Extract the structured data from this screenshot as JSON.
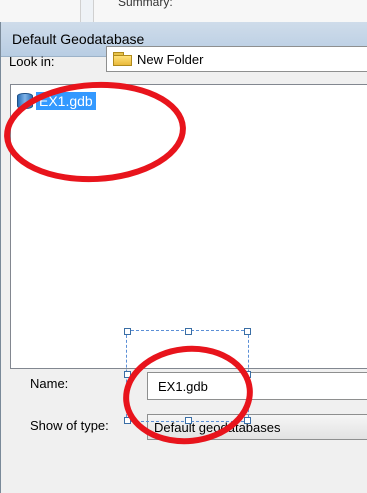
{
  "backdrop": {
    "text": "Summary:"
  },
  "dialog": {
    "title": "Default Geodatabase",
    "look_in_label": "Look in:",
    "look_in_value": "New Folder",
    "items": [
      {
        "label": "EX1.gdb",
        "icon": "geodatabase-icon",
        "selected": true
      }
    ],
    "name_label": "Name:",
    "name_value": "EX1.gdb",
    "type_label": "Show of type:",
    "type_value": "Default geodatabases"
  },
  "annotation": {
    "color": "#e8141c"
  },
  "colors": {
    "selection": "#3399ff",
    "title_bar": "#c3d4e6"
  }
}
